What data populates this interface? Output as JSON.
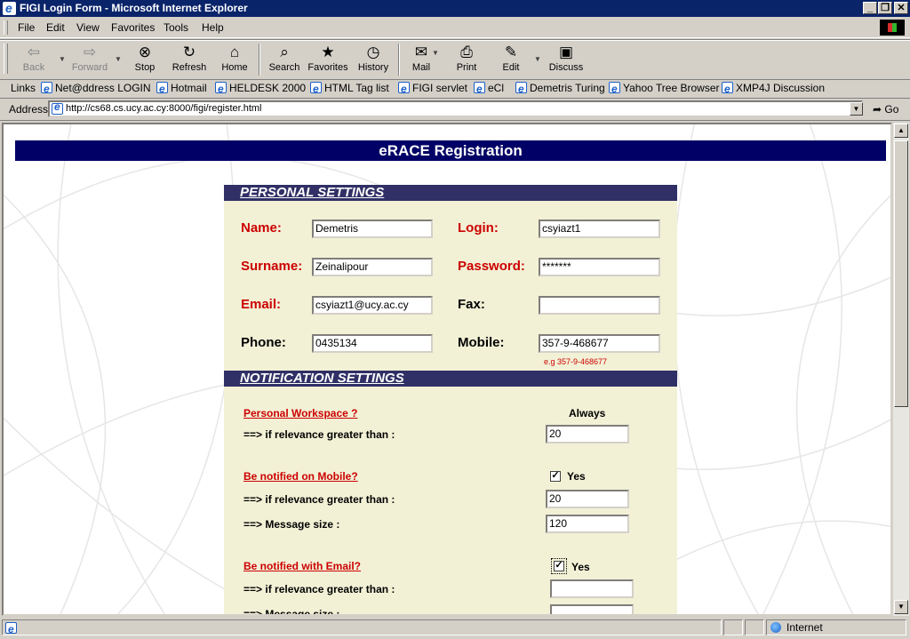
{
  "window": {
    "title": "FIGI Login Form - Microsoft Internet Explorer",
    "min": "_",
    "max": "❐",
    "close": "✕"
  },
  "menu": [
    "File",
    "Edit",
    "View",
    "Favorites",
    "Tools",
    "Help"
  ],
  "toolbar": {
    "back": "Back",
    "forward": "Forward",
    "stop": "Stop",
    "refresh": "Refresh",
    "home": "Home",
    "search": "Search",
    "favorites": "Favorites",
    "history": "History",
    "mail": "Mail",
    "print": "Print",
    "edit": "Edit",
    "discuss": "Discuss"
  },
  "links": {
    "label": "Links",
    "items": [
      "Net@ddress LOGIN",
      "Hotmail",
      "HELDESK 2000",
      "HTML Tag list",
      "FIGI servlet",
      "eCl",
      "Demetris Turing",
      "Yahoo Tree Browser",
      "XMP4J Discussion"
    ]
  },
  "address": {
    "label": "Address",
    "url": "http://cs68.cs.ucy.ac.cy:8000/figi/register.html",
    "go": "Go"
  },
  "page": {
    "banner": "eRACE Registration",
    "personal": {
      "heading": "PERSONAL SETTINGS",
      "name_label": "Name:",
      "name_value": "Demetris",
      "login_label": "Login:",
      "login_value": "csyiazt1",
      "surname_label": "Surname:",
      "surname_value": "Zeinalipour",
      "password_label": "Password:",
      "password_value": "*******",
      "email_label": "Email:",
      "email_value": "csyiazt1@ucy.ac.cy",
      "fax_label": "Fax:",
      "fax_value": "",
      "phone_label": "Phone:",
      "phone_value": "0435134",
      "mobile_label": "Mobile:",
      "mobile_value": "357-9-468677",
      "mobile_hint": "e.g 357-9-468677"
    },
    "notification": {
      "heading": "NOTIFICATION SETTINGS",
      "workspace_link": "Personal Workspace ?",
      "always": "Always",
      "relevance_row": "==>   if relevance greater than :",
      "size_row": "==>   Message size :",
      "workspace_relevance": "20",
      "mobile_link": "Be notified on Mobile?",
      "mobile_yes": "Yes",
      "mobile_check": "✓",
      "mobile_relevance": "20",
      "mobile_size": "120",
      "email_link": "Be notified with Email?",
      "email_yes": "Yes",
      "email_check": "✓",
      "email_relevance": "",
      "email_size": ""
    }
  },
  "status": {
    "zone": "Internet"
  }
}
